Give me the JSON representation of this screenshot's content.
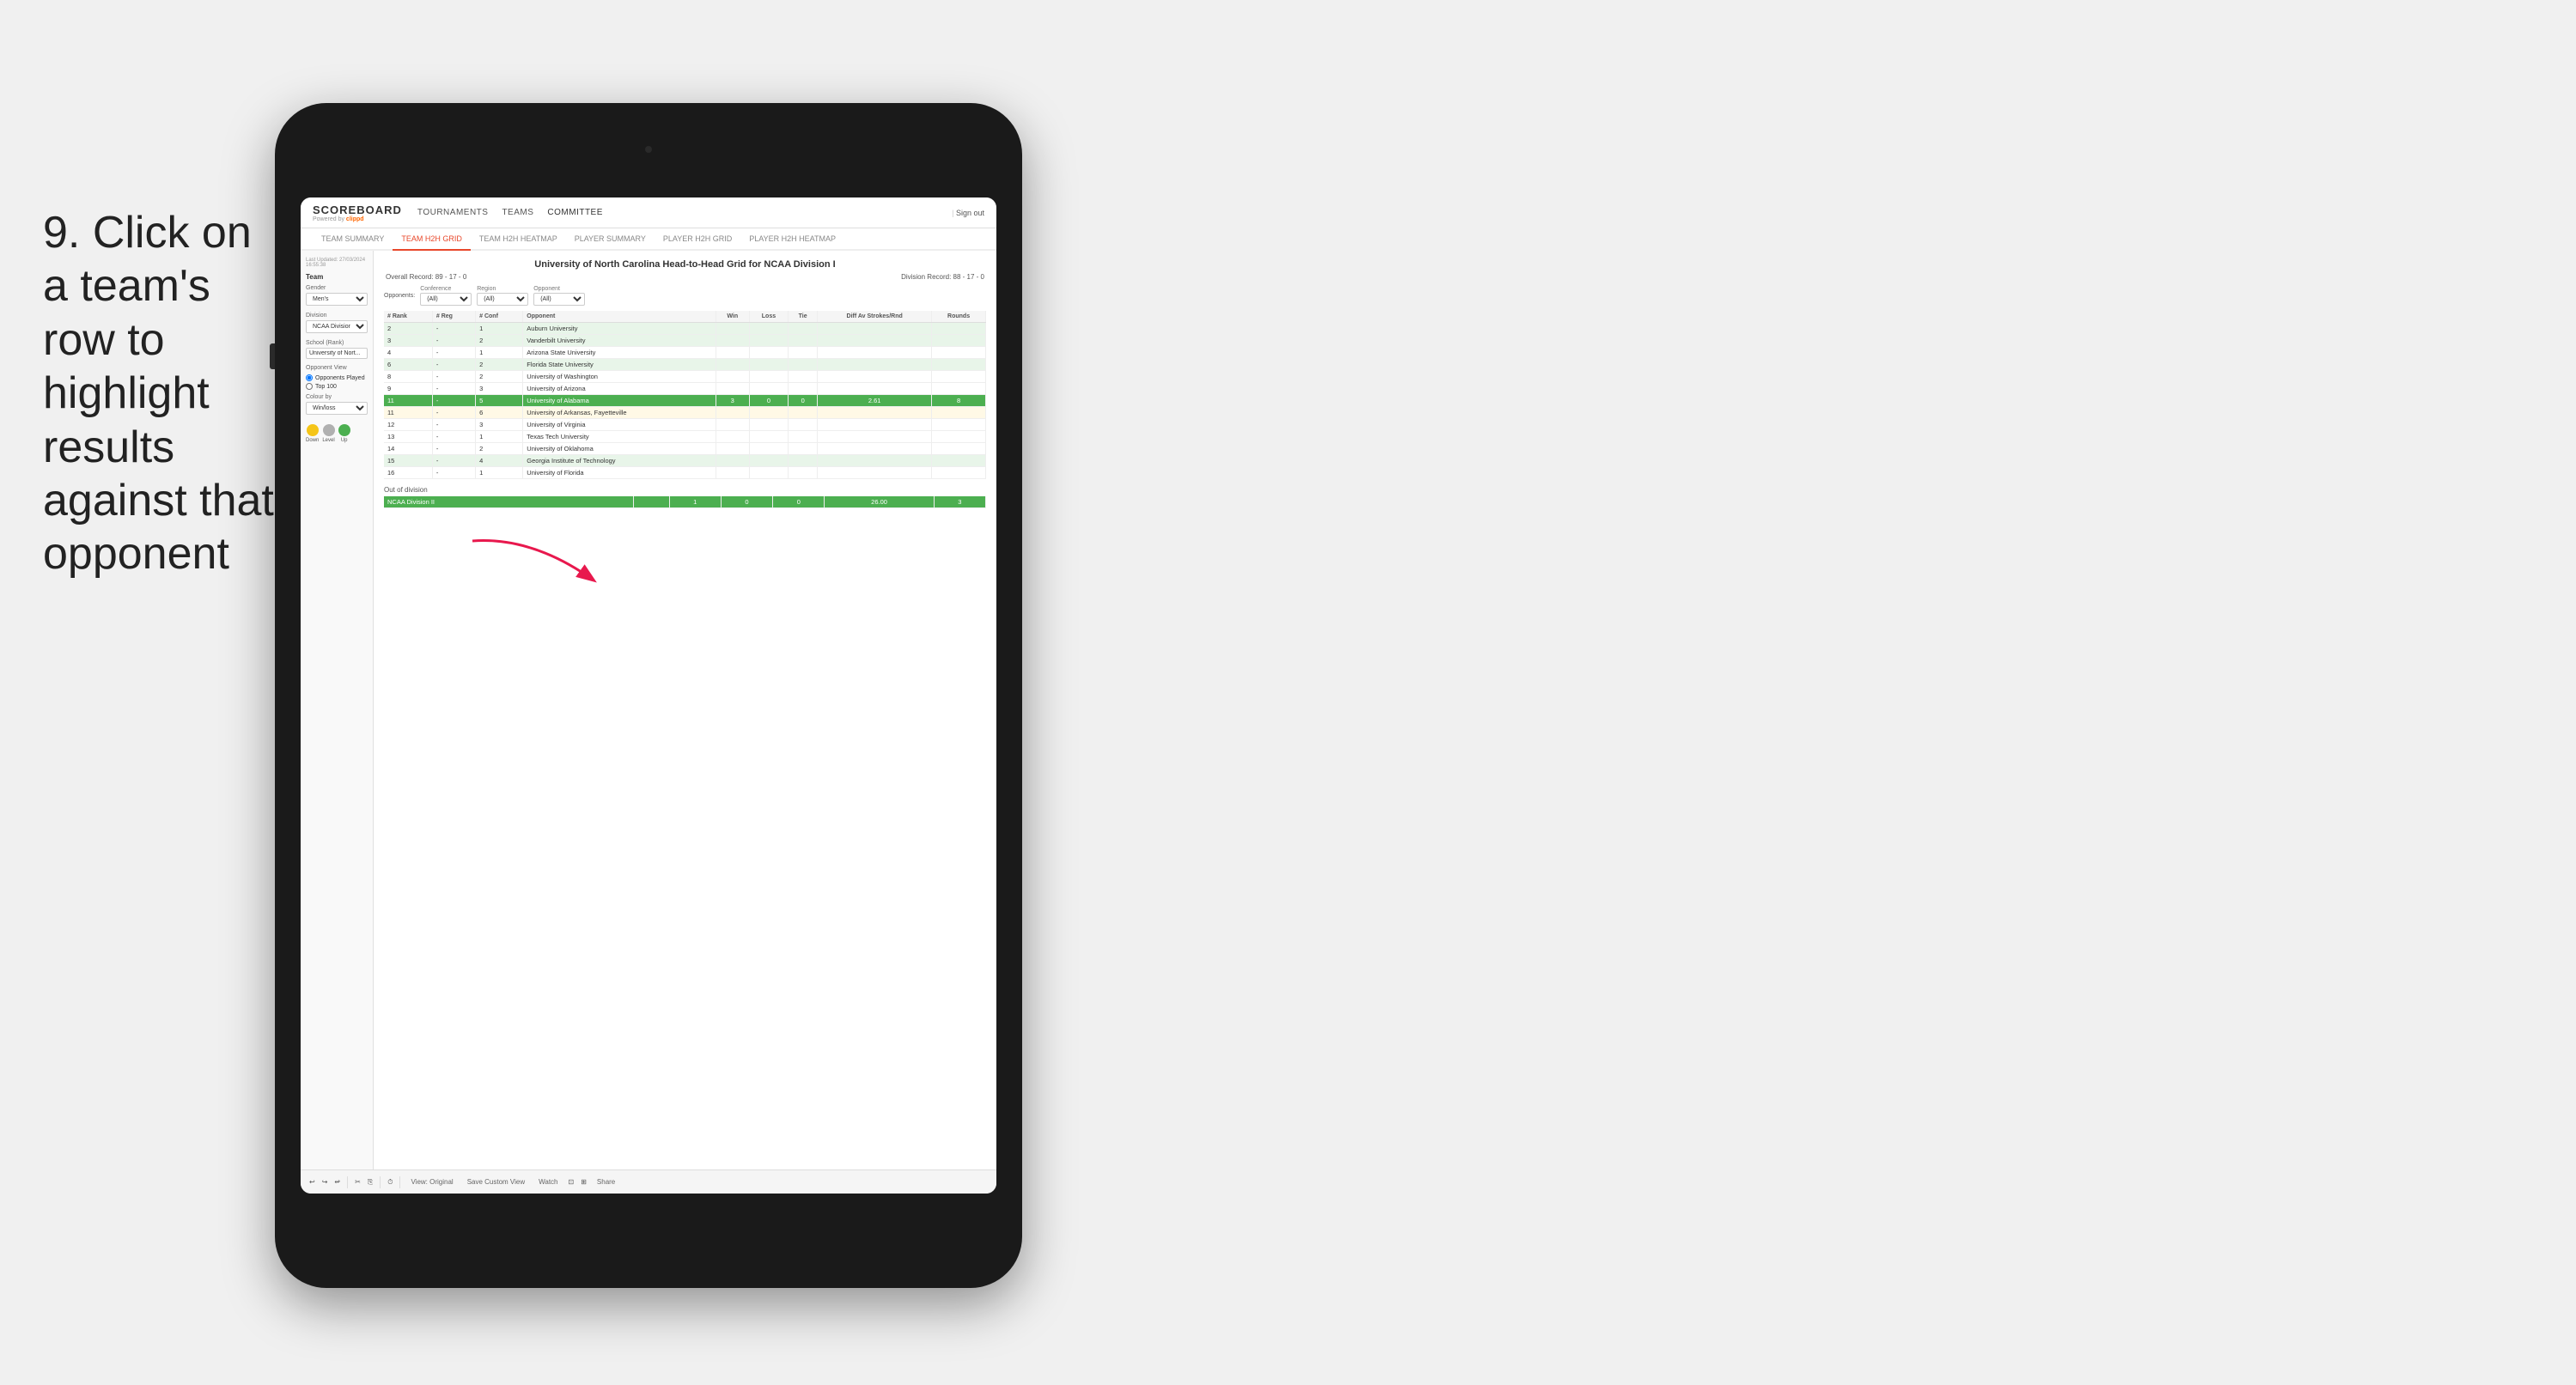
{
  "instruction": {
    "step_number": "9.",
    "text": "Click on a team's row to highlight results against that opponent"
  },
  "nav": {
    "logo": "SCOREBOARD",
    "powered_by": "Powered by clippd",
    "items": [
      "TOURNAMENTS",
      "TEAMS",
      "COMMITTEE"
    ],
    "sign_out": "Sign out"
  },
  "sub_nav": {
    "items": [
      "TEAM SUMMARY",
      "TEAM H2H GRID",
      "TEAM H2H HEATMAP",
      "PLAYER SUMMARY",
      "PLAYER H2H GRID",
      "PLAYER H2H HEATMAP"
    ],
    "active": "TEAM H2H GRID"
  },
  "left_panel": {
    "timestamp_label": "Last Updated: 27/03/2024",
    "time": "16:55:38",
    "team_label": "Team",
    "gender_label": "Gender",
    "gender_value": "Men's",
    "division_label": "Division",
    "division_value": "NCAA Division I",
    "school_label": "School (Rank)",
    "school_value": "University of Nort...",
    "opponent_view_label": "Opponent View",
    "opponent_options": [
      "Opponents Played",
      "Top 100"
    ],
    "colour_by_label": "Colour by",
    "colour_by_value": "Win/loss",
    "legend": [
      {
        "label": "Down",
        "color": "#f5c518"
      },
      {
        "label": "Level",
        "color": "#b0b0b0"
      },
      {
        "label": "Up",
        "color": "#4caf50"
      }
    ]
  },
  "main": {
    "title": "University of North Carolina Head-to-Head Grid for NCAA Division I",
    "overall_record": "Overall Record: 89 - 17 - 0",
    "division_record": "Division Record: 88 - 17 - 0",
    "filters": {
      "opponents_label": "Opponents:",
      "conference_label": "Conference",
      "conference_value": "(All)",
      "region_label": "Region",
      "region_value": "(All)",
      "opponent_label": "Opponent",
      "opponent_value": "(All)"
    },
    "table_headers": [
      "# Rank",
      "# Reg",
      "# Conf",
      "Opponent",
      "Win",
      "Loss",
      "Tie",
      "Diff Av Strokes/Rnd",
      "Rounds"
    ],
    "rows": [
      {
        "rank": "2",
        "reg": "-",
        "conf": "1",
        "opponent": "Auburn University",
        "win": "",
        "loss": "",
        "tie": "",
        "diff": "",
        "rounds": "",
        "style": "light-green"
      },
      {
        "rank": "3",
        "reg": "-",
        "conf": "2",
        "opponent": "Vanderbilt University",
        "win": "",
        "loss": "",
        "tie": "",
        "diff": "",
        "rounds": "",
        "style": "light-green"
      },
      {
        "rank": "4",
        "reg": "-",
        "conf": "1",
        "opponent": "Arizona State University",
        "win": "",
        "loss": "",
        "tie": "",
        "diff": "",
        "rounds": "",
        "style": "normal"
      },
      {
        "rank": "6",
        "reg": "-",
        "conf": "2",
        "opponent": "Florida State University",
        "win": "",
        "loss": "",
        "tie": "",
        "diff": "",
        "rounds": "",
        "style": "light-green"
      },
      {
        "rank": "8",
        "reg": "-",
        "conf": "2",
        "opponent": "University of Washington",
        "win": "",
        "loss": "",
        "tie": "",
        "diff": "",
        "rounds": "",
        "style": "normal"
      },
      {
        "rank": "9",
        "reg": "-",
        "conf": "3",
        "opponent": "University of Arizona",
        "win": "",
        "loss": "",
        "tie": "",
        "diff": "",
        "rounds": "",
        "style": "normal"
      },
      {
        "rank": "11",
        "reg": "-",
        "conf": "5",
        "opponent": "University of Alabama",
        "win": "3",
        "loss": "0",
        "tie": "0",
        "diff": "2.61",
        "rounds": "8",
        "style": "highlighted"
      },
      {
        "rank": "11",
        "reg": "-",
        "conf": "6",
        "opponent": "University of Arkansas, Fayetteville",
        "win": "",
        "loss": "",
        "tie": "",
        "diff": "",
        "rounds": "",
        "style": "light-yellow"
      },
      {
        "rank": "12",
        "reg": "-",
        "conf": "3",
        "opponent": "University of Virginia",
        "win": "",
        "loss": "",
        "tie": "",
        "diff": "",
        "rounds": "",
        "style": "normal"
      },
      {
        "rank": "13",
        "reg": "-",
        "conf": "1",
        "opponent": "Texas Tech University",
        "win": "",
        "loss": "",
        "tie": "",
        "diff": "",
        "rounds": "",
        "style": "normal"
      },
      {
        "rank": "14",
        "reg": "-",
        "conf": "2",
        "opponent": "University of Oklahoma",
        "win": "",
        "loss": "",
        "tie": "",
        "diff": "",
        "rounds": "",
        "style": "normal"
      },
      {
        "rank": "15",
        "reg": "-",
        "conf": "4",
        "opponent": "Georgia Institute of Technology",
        "win": "",
        "loss": "",
        "tie": "",
        "diff": "",
        "rounds": "",
        "style": "light-green"
      },
      {
        "rank": "16",
        "reg": "-",
        "conf": "1",
        "opponent": "University of Florida",
        "win": "",
        "loss": "",
        "tie": "",
        "diff": "",
        "rounds": "",
        "style": "normal"
      }
    ],
    "out_of_division_label": "Out of division",
    "out_of_division_row": {
      "label": "NCAA Division II",
      "win": "1",
      "loss": "0",
      "tie": "0",
      "diff": "26.00",
      "rounds": "3"
    }
  },
  "toolbar": {
    "view_label": "View: Original",
    "save_label": "Save Custom View",
    "watch_label": "Watch",
    "share_label": "Share"
  }
}
